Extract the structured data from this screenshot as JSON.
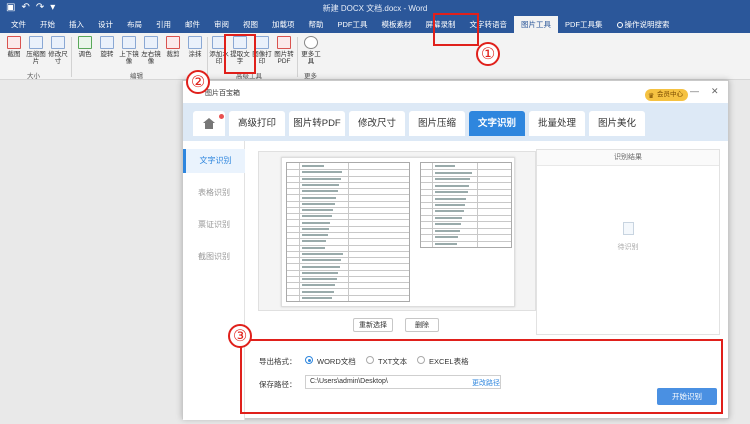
{
  "word": {
    "title": "新建 DOCX 文档.docx - Word",
    "tabs": [
      "文件",
      "开始",
      "插入",
      "设计",
      "布局",
      "引用",
      "邮件",
      "审阅",
      "视图",
      "加载项",
      "帮助",
      "PDF工具",
      "模板素材",
      "屏幕录制",
      "文字转语音",
      "图片工具",
      "PDF工具集",
      "操作说明搜索"
    ],
    "active_tab": "图片工具"
  },
  "ribbon": {
    "buttons": [
      {
        "label": "截图"
      },
      {
        "label": "压缩图片"
      },
      {
        "label": "修改尺寸"
      },
      {
        "label": "调色"
      },
      {
        "label": "旋转"
      },
      {
        "label": "上下镜像"
      },
      {
        "label": "左右镜像"
      },
      {
        "label": "裁剪"
      },
      {
        "label": "涂抹"
      },
      {
        "label": "添加水印"
      },
      {
        "label": "提取文字"
      },
      {
        "label": "图像打印"
      },
      {
        "label": "图片转PDF"
      },
      {
        "label": "更多工具"
      }
    ],
    "groups": {
      "size": "大小",
      "edit": "编辑",
      "advanced": "高级工具",
      "more": "更多"
    }
  },
  "annotations": {
    "n1": "①",
    "n2": "②",
    "n3": "③"
  },
  "dialog": {
    "title": "图片百宝箱",
    "member_label": "会员中心",
    "tabs": [
      "高级打印",
      "图片转PDF",
      "修改尺寸",
      "图片压缩",
      "文字识别",
      "批量处理",
      "图片美化"
    ],
    "active_tab": "文字识别",
    "sidebar": [
      "文字识别",
      "表格识别",
      "票证识别",
      "截图识别"
    ],
    "active_side": "文字识别",
    "buttons": {
      "reselect": "重新选择",
      "delete": "删除",
      "start": "开始识别"
    },
    "result_title": "识别结果",
    "pending": "待识别",
    "export_label": "导出格式：",
    "formats": [
      {
        "label": "WORD文档",
        "selected": true
      },
      {
        "label": "TXT文本",
        "selected": false
      },
      {
        "label": "EXCEL表格",
        "selected": false
      }
    ],
    "save_label": "保存路径：",
    "save_path": "C:\\Users\\admin\\Desktop\\",
    "change_path": "更改路径"
  },
  "colors": {
    "word_blue": "#2b579a",
    "accent": "#2e86de",
    "annotation_red": "#e0201b",
    "member_gold": "#f5c242"
  }
}
